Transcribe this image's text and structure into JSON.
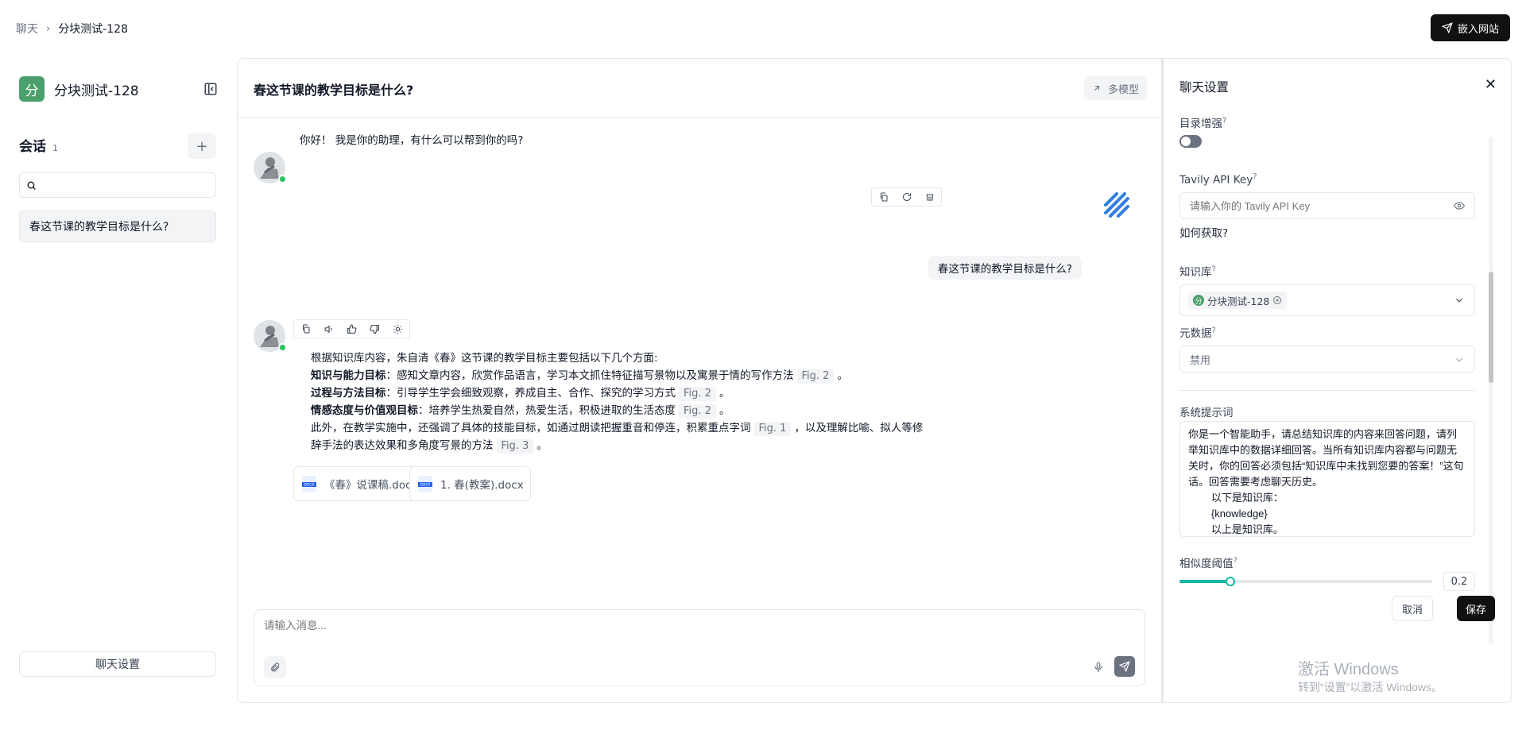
{
  "breadcrumb": {
    "root": "聊天",
    "separator": "›",
    "current": "分块测试-128"
  },
  "embed_button": "嵌入网站",
  "sidebar": {
    "kb_avatar": "分",
    "kb_name": "分块测试-128",
    "sessions_title": "会话",
    "sessions_count": "1",
    "search_placeholder": "",
    "sessions": [
      {
        "title": "春这节课的教学目标是什么?"
      }
    ],
    "chat_settings_button": "聊天设置"
  },
  "chat": {
    "title": "春这节课的教学目标是什么?",
    "multi_model": "多模型",
    "greeting": "你好！ 我是你的助理，有什么可以帮到你的吗?",
    "user_message": "春这节课的教学目标是什么?",
    "answer": {
      "intro": "根据知识库内容，朱自清《春》这节课的教学目标主要包括以下几个方面:",
      "items": [
        {
          "label": "知识与能力目标",
          "text": "：感知文章内容，欣赏作品语言，学习本文抓住特征描写景物以及寓景于情的写作方法",
          "fig": "Fig. 2",
          "end": "。"
        },
        {
          "label": "过程与方法目标",
          "text": "：引导学生学会细致观察，养成自主、合作、探究的学习方式",
          "fig": "Fig. 2",
          "end": "。"
        },
        {
          "label": "情感态度与价值观目标",
          "text": "：培养学生热爱自然，热爱生活，积极进取的生活态度",
          "fig": "Fig. 2",
          "end": "。"
        }
      ],
      "extra_line1": "此外，在教学实施中，还强调了具体的技能目标，如通过朗读把握重音和停连，积累重点字词",
      "extra_fig1": "Fig. 1",
      "extra_line1_end": "，以及理解比喻、拟人等修",
      "extra_line2": "辞手法的表达效果和多角度写景的方法",
      "extra_fig2": "Fig. 3",
      "extra_line2_end": "。"
    },
    "documents": [
      {
        "badge": "DOCX",
        "name": "《春》说课稿.docx"
      },
      {
        "badge": "DOCX",
        "name": "1. 春(教案).docx"
      }
    ],
    "input_placeholder": "请输入消息..."
  },
  "settings": {
    "title": "聊天设置",
    "toc_label": "目录增强",
    "toc_enabled": false,
    "tavily_label": "Tavily API Key",
    "tavily_placeholder": "请输入你的 Tavily API Key",
    "how_to_get": "如何获取?",
    "kb_label": "知识库",
    "kb_tag_icon": "分",
    "kb_tag": "分块测试-128",
    "metadata_label": "元数据",
    "metadata_value": "禁用",
    "system_prompt_label": "系统提示词",
    "system_prompt": "你是一个智能助手，请总结知识库的内容来回答问题，请列举知识库中的数据详细回答。当所有知识库内容都与问题无关时，你的回答必须包括“知识库中未找到您要的答案！”这句话。回答需要考虑聊天历史。\n        以下是知识库：\n        {knowledge}\n        以上是知识库。",
    "similarity_label": "相似度阈值",
    "similarity_value": "0.2",
    "similarity_fraction": 0.2,
    "cancel": "取消",
    "save": "保存"
  },
  "watermark": {
    "line1": "激活 Windows",
    "line2": "转到“设置”以激活 Windows。"
  },
  "colors": {
    "accent": "#14b8a6",
    "kb_green": "#4ca06d",
    "online": "#22c55e",
    "primary_button": "#111111"
  }
}
